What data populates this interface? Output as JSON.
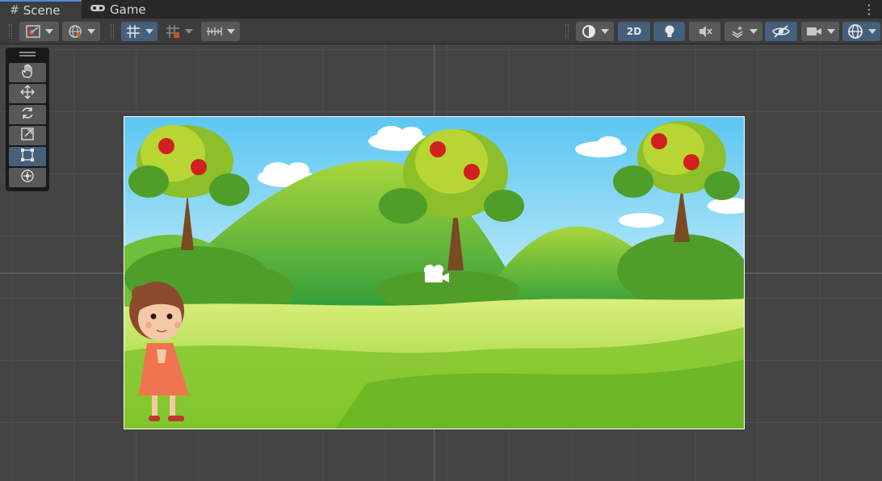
{
  "tabs": [
    {
      "label": "Scene",
      "icon": "grid-icon",
      "active": true
    },
    {
      "label": "Game",
      "icon": "gamepad-icon",
      "active": false
    }
  ],
  "toolbar": {
    "left_buttons": [
      "draw-mode",
      "global-toggle",
      "grid-snapping",
      "increment-snap",
      "view-options"
    ],
    "right_buttons": [
      "shading-mode",
      "2D",
      "lighting",
      "audio",
      "effects",
      "scene-visibility",
      "camera",
      "gizmos"
    ],
    "mode_2d_label": "2D"
  },
  "tools": [
    "view-tool",
    "move-tool",
    "rotate-tool",
    "scale-tool",
    "rect-tool",
    "transform-tool"
  ],
  "active_tool": "rect-tool",
  "scene": {
    "background": "apple orchard with hills",
    "character": "girl in orange dress"
  },
  "colors": {
    "accent": "#4d8bd9",
    "active_button": "#46607c",
    "button": "#585858",
    "panel": "#3c3c3c"
  }
}
